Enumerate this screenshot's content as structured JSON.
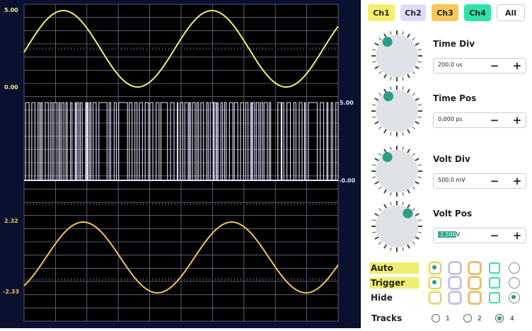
{
  "scope": {
    "colors": {
      "background": "#0d1230",
      "frame": "#0a1030",
      "grid": "#6e7186",
      "ch1": "#f2ee6f",
      "ch2": "#e2e0fb",
      "ch3": "#f4c35a"
    },
    "ch1_scale": {
      "top": "5.00",
      "bottom": "0.00"
    },
    "ch2_scale": {
      "top": "5.00",
      "bottom": "-0.00"
    },
    "ch3_scale": {
      "top": "2.32",
      "bottom": "-2.33"
    }
  },
  "channels": [
    {
      "label": "Ch1",
      "color": "#f2ee6f"
    },
    {
      "label": "Ch2",
      "color": "#dcdcfa"
    },
    {
      "label": "Ch3",
      "color": "#f6c85c"
    },
    {
      "label": "Ch4",
      "color": "#2fe3a6"
    },
    {
      "label": "All",
      "color": "#ffffff"
    }
  ],
  "controls": [
    {
      "label": "Time Div",
      "value": "200,0 us"
    },
    {
      "label": "Time Pos",
      "value": "0,000 ps"
    },
    {
      "label": "Volt Div",
      "value": "500,0 mV"
    },
    {
      "label": "Volt Pos",
      "value_sel": "-2,500",
      "value_unit": "V"
    }
  ],
  "buttons": {
    "minus": "−",
    "plus": "+"
  },
  "matrix": {
    "rows": [
      {
        "label": "Auto",
        "highlight": "#f0ee70",
        "states": [
          true,
          false,
          false,
          false,
          false
        ]
      },
      {
        "label": "Trigger",
        "highlight": "#f0ee70",
        "states": [
          true,
          false,
          false,
          false,
          false
        ]
      },
      {
        "label": "Hide",
        "highlight": "",
        "states": [
          false,
          false,
          false,
          false,
          true
        ]
      }
    ],
    "column_colors": [
      "#f2ee6f",
      "#c8c8ee",
      "#f4c35a",
      "#2fe3a6",
      "#999999"
    ]
  },
  "tracks": {
    "label": "Tracks",
    "options": [
      "1",
      "2",
      "4"
    ],
    "selected": "4"
  }
}
